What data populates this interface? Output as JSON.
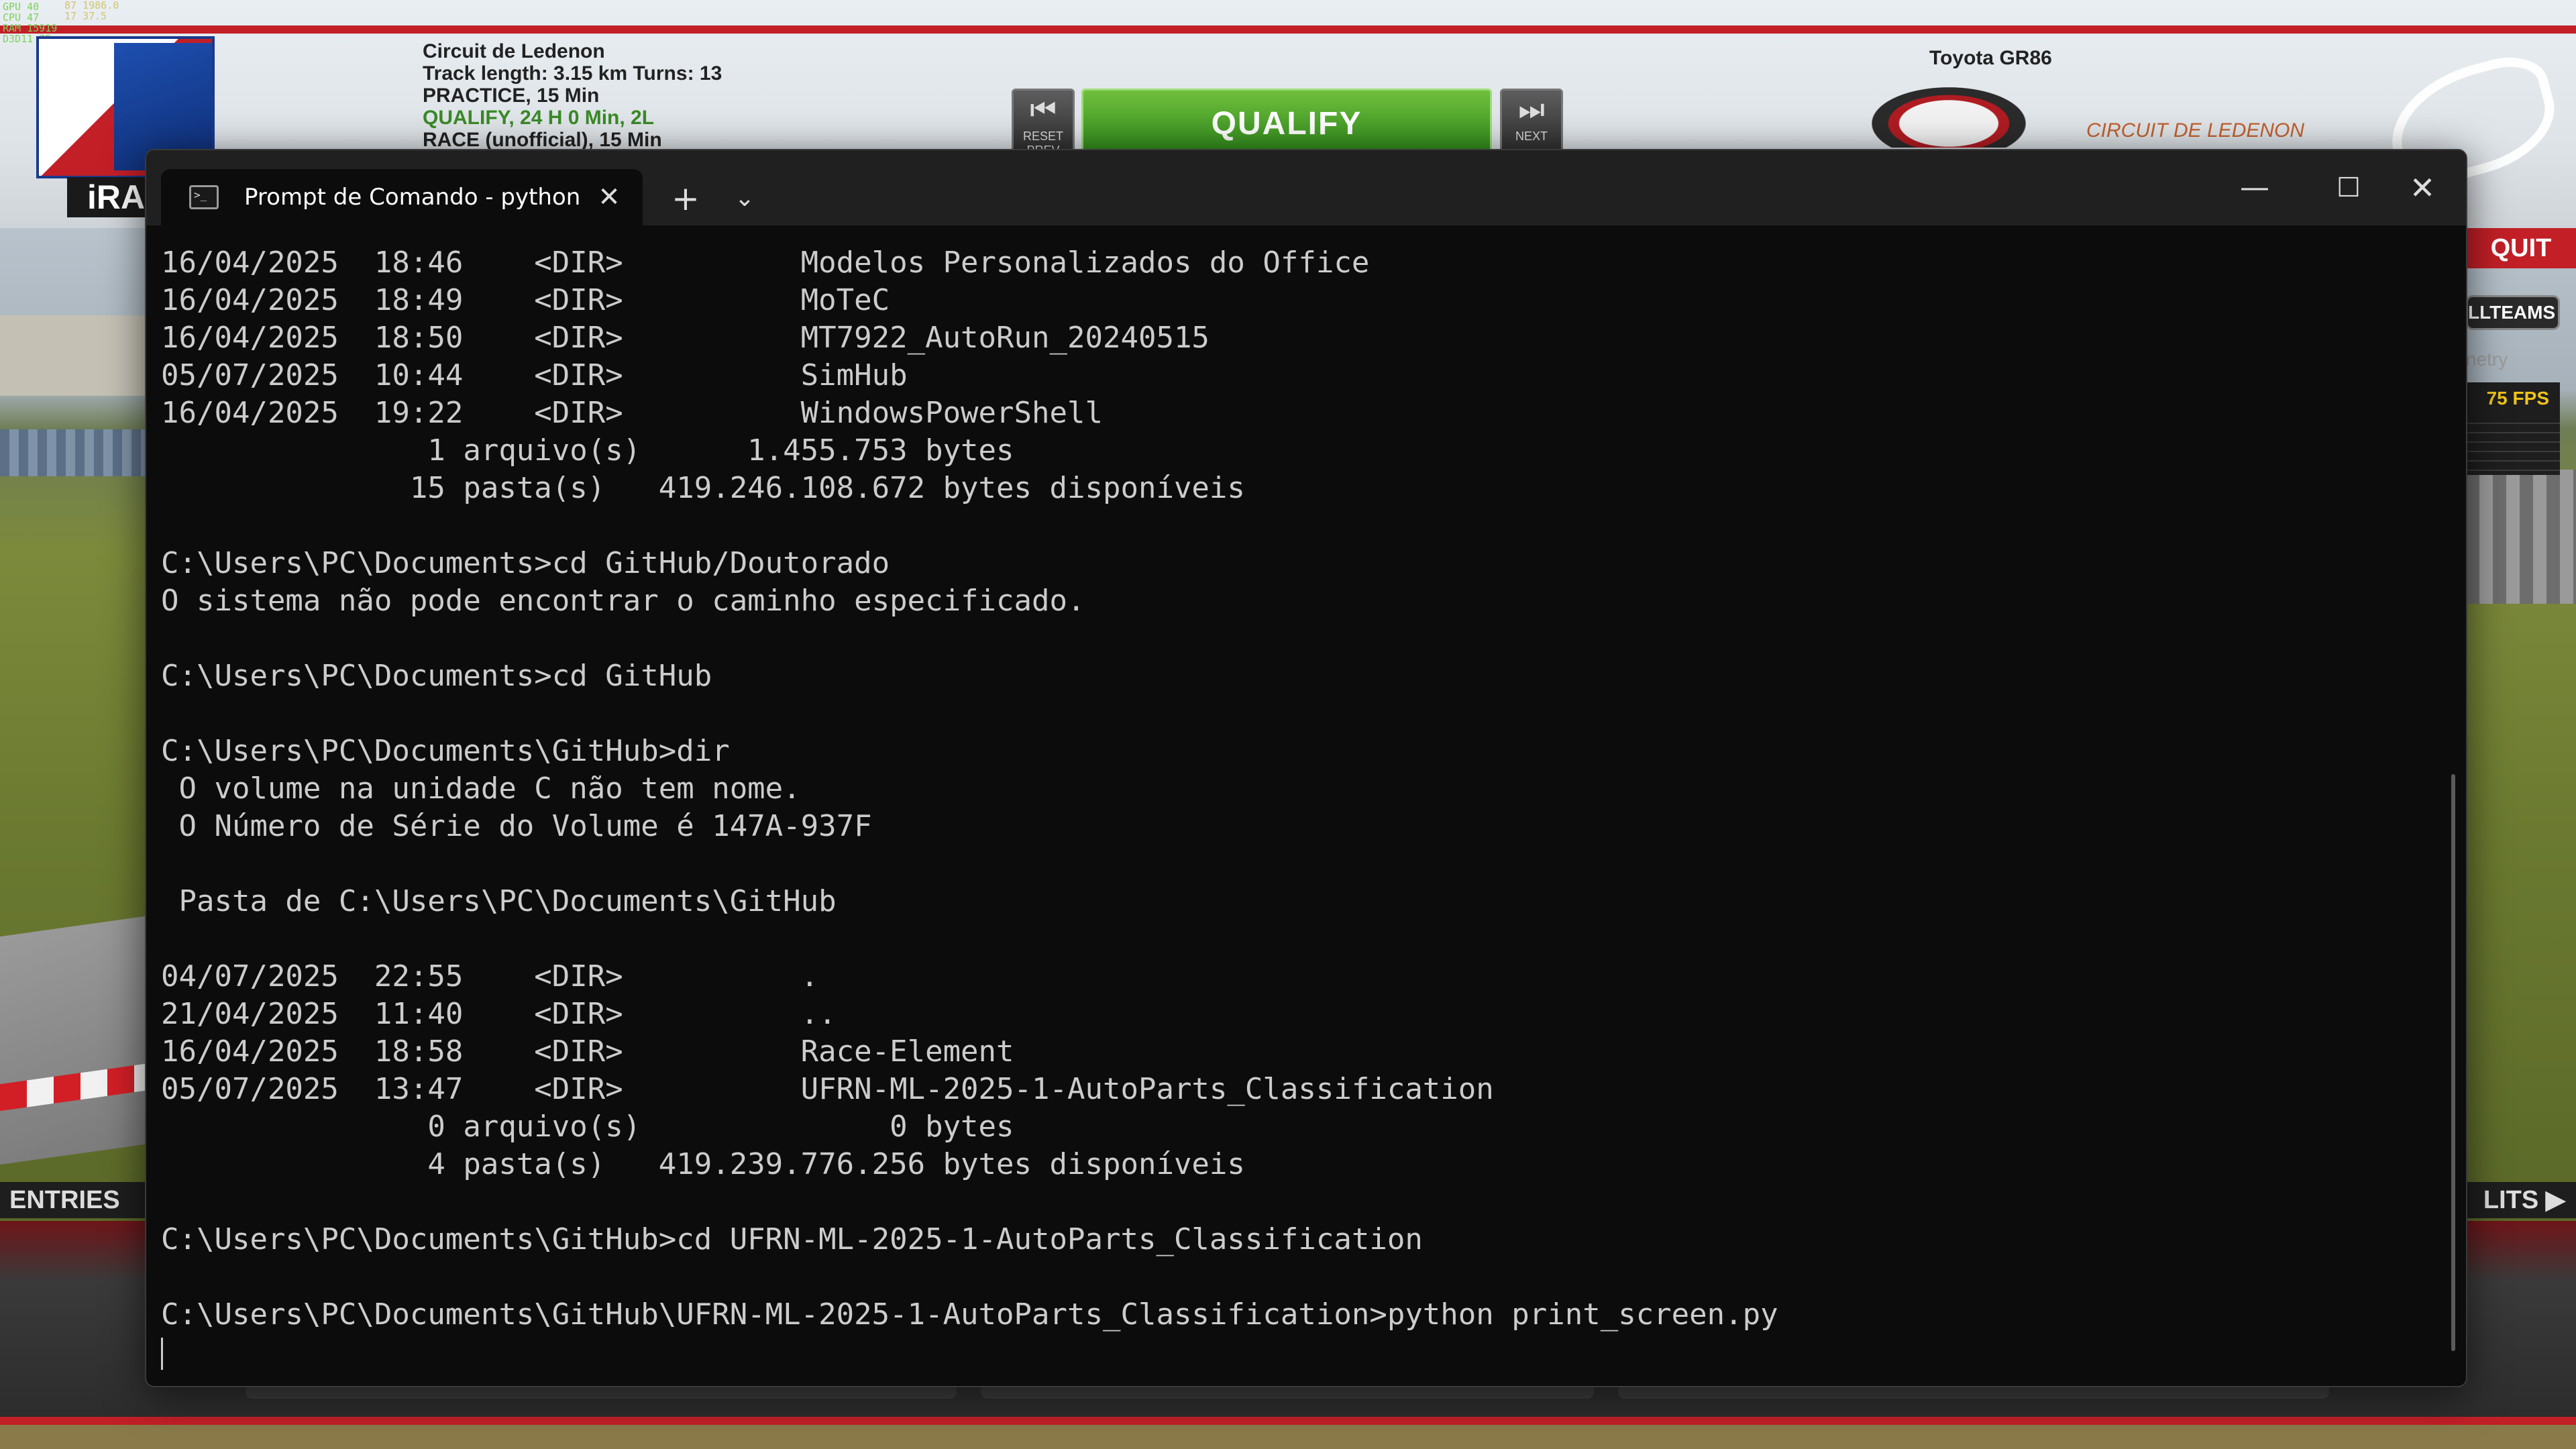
{
  "background_app": {
    "hud_left": [
      "GPU  40",
      "CPU  47",
      "RAM  15919",
      "D3D11  75"
    ],
    "hud_right": [
      "87  1986.0",
      "17  37.5"
    ],
    "logo_text": "iRAC",
    "session": {
      "track": "Circuit de Ledenon",
      "track_info": "Track length: 3.15 km Turns: 13",
      "practice": "PRACTICE, 15 Min",
      "qualify": "QUALIFY, 24 H 0 Min, 2L",
      "race": "RACE (unofficial), 15 Min"
    },
    "reset_label": "RESET PREV",
    "qualify_label": "QUALIFY",
    "next_label": "NEXT",
    "car_name": "Toyota GR86",
    "track_logo_text": "CIRCUIT DE LEDENON",
    "quit_label": "QUIT",
    "allteams_label": "LLTEAMS",
    "telemetry_label": "netry",
    "fps_label": "75 FPS",
    "entries_label": "ENTRIES",
    "results_label": "LITS ▶"
  },
  "terminal": {
    "tab_title": "Prompt de Comando - python",
    "tab_icon_prompt": ">_",
    "close_tab_icon": "✕",
    "new_tab_icon": "+",
    "dropdown_icon": "⌄",
    "minimize_icon": "—",
    "maximize_icon": "☐",
    "close_window_icon": "✕",
    "lines": [
      "16/04/2025  18:46    <DIR>          Modelos Personalizados do Office",
      "16/04/2025  18:49    <DIR>          MoTeC",
      "16/04/2025  18:50    <DIR>          MT7922_AutoRun_20240515",
      "05/07/2025  10:44    <DIR>          SimHub",
      "16/04/2025  19:22    <DIR>          WindowsPowerShell",
      "               1 arquivo(s)      1.455.753 bytes",
      "              15 pasta(s)   419.246.108.672 bytes disponíveis",
      "",
      "C:\\Users\\PC\\Documents>cd GitHub/Doutorado",
      "O sistema não pode encontrar o caminho especificado.",
      "",
      "C:\\Users\\PC\\Documents>cd GitHub",
      "",
      "C:\\Users\\PC\\Documents\\GitHub>dir",
      " O volume na unidade C não tem nome.",
      " O Número de Série do Volume é 147A-937F",
      "",
      " Pasta de C:\\Users\\PC\\Documents\\GitHub",
      "",
      "04/07/2025  22:55    <DIR>          .",
      "21/04/2025  11:40    <DIR>          ..",
      "16/04/2025  18:58    <DIR>          Race-Element",
      "05/07/2025  13:47    <DIR>          UFRN-ML-2025-1-AutoParts_Classification",
      "               0 arquivo(s)              0 bytes",
      "               4 pasta(s)   419.239.776.256 bytes disponíveis",
      "",
      "C:\\Users\\PC\\Documents\\GitHub>cd UFRN-ML-2025-1-AutoParts_Classification",
      "",
      "C:\\Users\\PC\\Documents\\GitHub\\UFRN-ML-2025-1-AutoParts_Classification>python print_screen.py"
    ]
  }
}
